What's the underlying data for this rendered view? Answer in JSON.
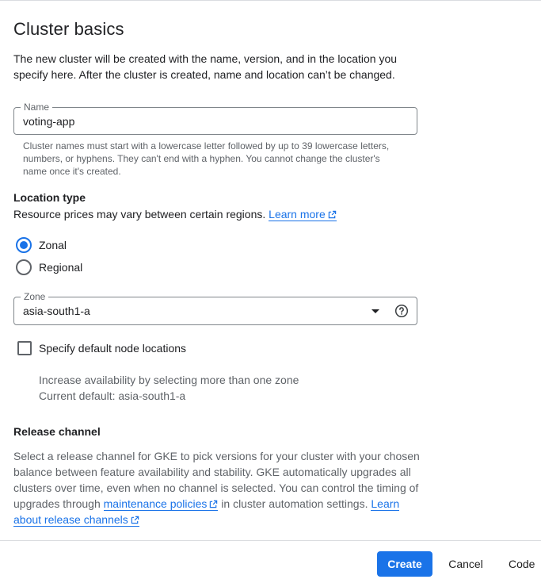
{
  "header": {
    "title": "Cluster basics",
    "intro": "The new cluster will be created with the name, version, and in the location you specify here. After the cluster is created, name and location can’t be changed."
  },
  "name_field": {
    "label": "Name",
    "value": "voting-app",
    "hint": "Cluster names must start with a lowercase letter followed by up to 39 lowercase letters, numbers, or hyphens. They can't end with a hyphen. You cannot change the cluster's name once it's created."
  },
  "location_type": {
    "title": "Location type",
    "description": "Resource prices may vary between certain regions.",
    "learn_more": "Learn more",
    "options": [
      {
        "label": "Zonal",
        "selected": true
      },
      {
        "label": "Regional",
        "selected": false
      }
    ]
  },
  "zone_field": {
    "label": "Zone",
    "value": "asia-south1-a"
  },
  "default_node_locations": {
    "label": "Specify default node locations",
    "checked": false,
    "note_line1": "Increase availability by selecting more than one zone",
    "note_line2": "Current default: asia-south1-a"
  },
  "release_channel": {
    "title": "Release channel",
    "text_part1": "Select a release channel for GKE to pick versions for your cluster with your chosen balance between feature availability and stability. GKE automatically upgrades all clusters over time, even when no channel is selected. You can control the timing of upgrades through ",
    "link_maintenance": "maintenance policies",
    "text_part2": " in cluster automation settings. ",
    "link_learn": "Learn about release channels"
  },
  "footer": {
    "create_label": "Create",
    "cancel_label": "Cancel",
    "code_label": "Code"
  },
  "colors": {
    "accent": "#1a73e8",
    "text": "#202124",
    "secondary_text": "#5f6368",
    "border": "#80868b"
  }
}
